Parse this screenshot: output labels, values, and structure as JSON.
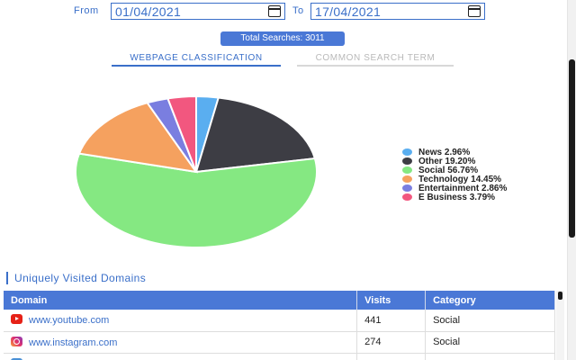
{
  "filters": {
    "from_label": "From",
    "from_value": "01/04/2021",
    "to_label": "To",
    "to_value": "17/04/2021"
  },
  "summary": {
    "total_searches": "Total Searches: 3011"
  },
  "tabs": [
    {
      "label": "WEBPAGE CLASSIFICATION",
      "active": true
    },
    {
      "label": "COMMON SEARCH TERM",
      "active": false
    }
  ],
  "chart_data": {
    "type": "pie",
    "slices": [
      {
        "label": "News",
        "value": 2.96,
        "color": "#5aaef0"
      },
      {
        "label": "Other",
        "value": 19.2,
        "color": "#3d3d44"
      },
      {
        "label": "Social",
        "value": 56.76,
        "color": "#85e882"
      },
      {
        "label": "Technology",
        "value": 14.45,
        "color": "#f5a15f"
      },
      {
        "label": "Entertainment",
        "value": 2.86,
        "color": "#7a7ee0"
      },
      {
        "label": "E Business",
        "value": 3.79,
        "color": "#f2577f"
      }
    ],
    "legend_text": [
      "News 2.96%",
      "Other 19.20%",
      "Social 56.76%",
      "Technology 14.45%",
      "Entertainment 2.86%",
      "E Business 3.79%"
    ],
    "legend_position": "right"
  },
  "domains": {
    "title": "Uniquely Visited Domains",
    "columns": [
      "Domain",
      "Visits",
      "Category"
    ],
    "rows": [
      {
        "icon": "youtube-icon",
        "domain": "www.youtube.com",
        "visits": "441",
        "category": "Social"
      },
      {
        "icon": "instagram-icon",
        "domain": "www.instagram.com",
        "visits": "274",
        "category": "Social"
      }
    ]
  }
}
